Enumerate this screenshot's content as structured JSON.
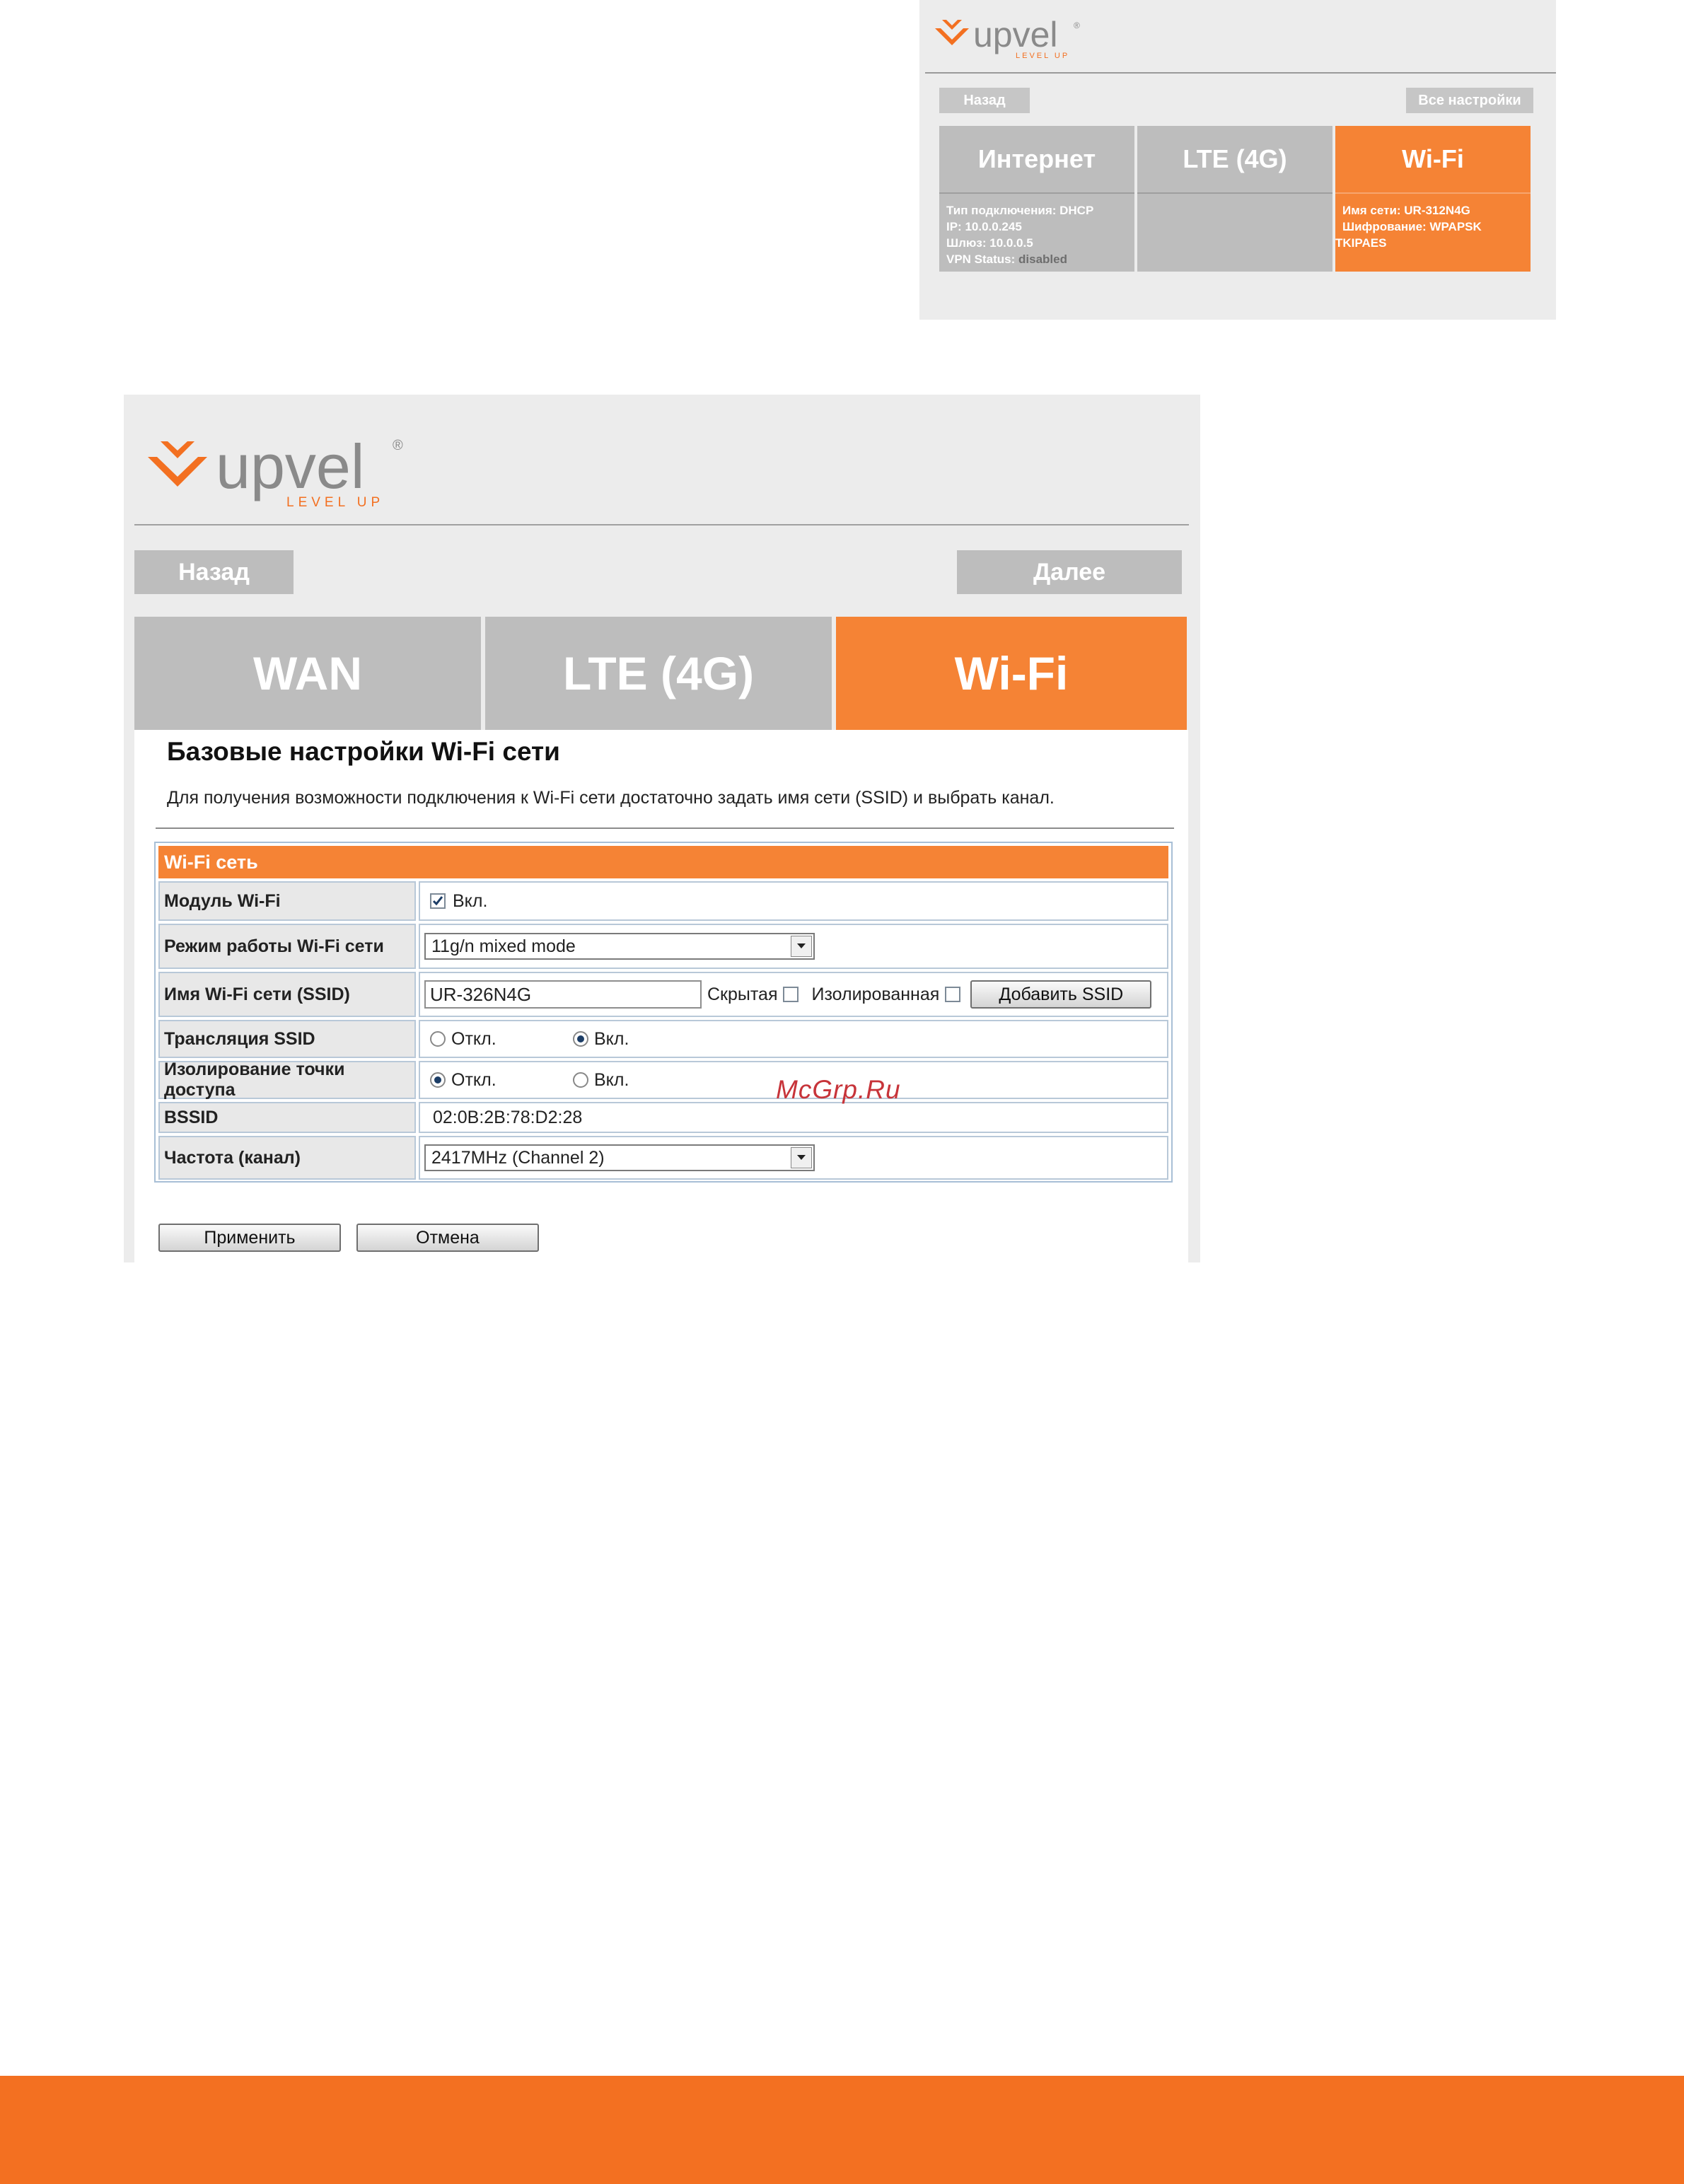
{
  "small_screen": {
    "logo_text": "upvel",
    "logo_reg": "®",
    "logo_tag": "LEVEL UP",
    "back_label": "Назад",
    "all_settings_label": "Все настройки",
    "tabs": [
      {
        "label": "Интернет",
        "lines": [
          "Тип подключения: DHCP",
          "IP: 10.0.0.245",
          "Шлюз: 10.0.0.5"
        ],
        "vpn_label": "VPN Status:",
        "vpn_value": "disabled"
      },
      {
        "label": "LTE (4G)"
      },
      {
        "label": "Wi-Fi",
        "lines": [
          "Имя сети: UR-312N4G",
          "Шифрование: WPAPSK",
          "TKIPAES"
        ]
      }
    ]
  },
  "big_screen": {
    "logo_text": "upvel",
    "logo_reg": "®",
    "logo_tag": "LEVEL UP",
    "back_label": "Назад",
    "next_label": "Далее",
    "tabs": [
      "WAN",
      "LTE (4G)",
      "Wi-Fi"
    ],
    "title": "Базовые настройки Wi-Fi сети",
    "description": "Для получения возможности подключения к Wi-Fi сети достаточно задать имя сети (SSID) и выбрать канал.",
    "section_header": "Wi-Fi сеть",
    "rows": {
      "module": {
        "label": "Модуль Wi-Fi",
        "checkbox_label": "Вкл.",
        "checked": true
      },
      "mode": {
        "label": "Режим работы Wi-Fi сети",
        "selected": "11g/n mixed mode"
      },
      "ssid": {
        "label": "Имя Wi-Fi сети (SSID)",
        "value": "UR-326N4G",
        "hidden_label": "Скрытая",
        "isolated_label": "Изолированная",
        "add_button": "Добавить SSID"
      },
      "broadcast": {
        "label": "Трансляция SSID",
        "off_label": "Откл.",
        "on_label": "Вкл.",
        "selected": "on"
      },
      "isolation": {
        "label": "Изолирование точки доступа",
        "off_label": "Откл.",
        "on_label": "Вкл.",
        "selected": "off"
      },
      "bssid": {
        "label": "BSSID",
        "value": "02:0B:2B:78:D2:28"
      },
      "channel": {
        "label": "Частота (канал)",
        "selected": "2417MHz (Channel 2)"
      }
    },
    "apply_label": "Применить",
    "cancel_label": "Отмена"
  },
  "watermark": "McGrp.Ru",
  "colors": {
    "accent": "#f58335",
    "footer": "#f37021",
    "tab_gray": "#bdbdbd"
  }
}
